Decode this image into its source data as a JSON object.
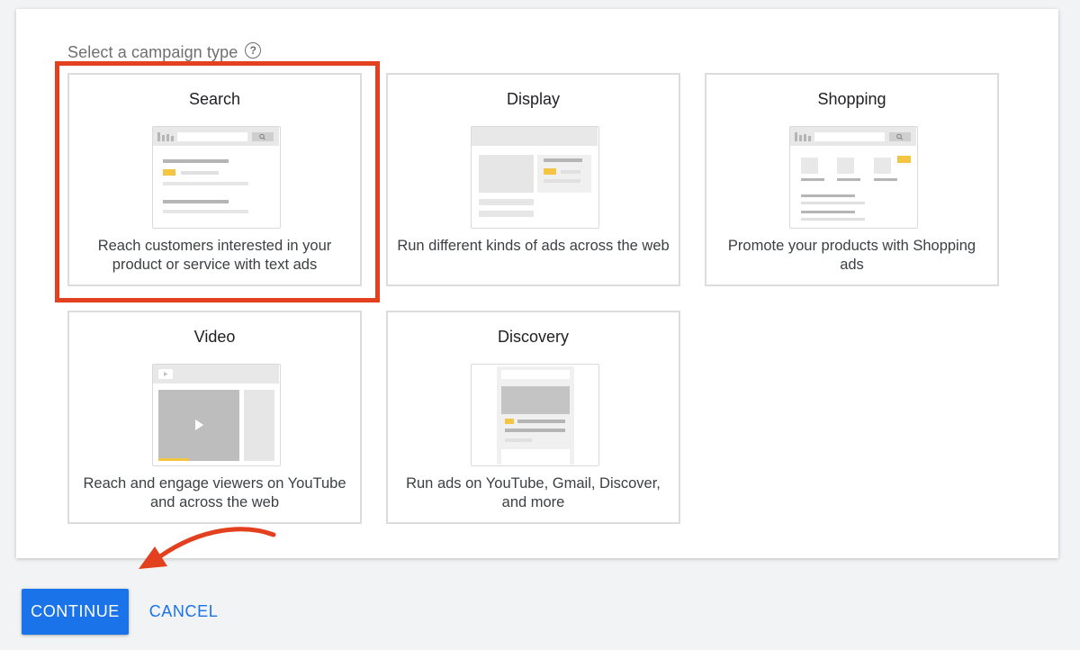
{
  "section": {
    "label": "Select a campaign type",
    "help_icon": "?"
  },
  "campaign_types": [
    {
      "title": "Search",
      "description": "Reach customers interested in your product or service with text ads",
      "selected": true
    },
    {
      "title": "Display",
      "description": "Run different kinds of ads across the web",
      "selected": false
    },
    {
      "title": "Shopping",
      "description": "Promote your products with Shopping ads",
      "selected": false
    },
    {
      "title": "Video",
      "description": "Reach and engage viewers on YouTube and across the web",
      "selected": false
    },
    {
      "title": "Discovery",
      "description": "Run ads on YouTube, Gmail, Discover, and more",
      "selected": false
    }
  ],
  "actions": {
    "continue_label": "CONTINUE",
    "cancel_label": "CANCEL"
  },
  "colors": {
    "accent": "#1a73e8",
    "highlight": "#e2401e",
    "thumb_yellow": "#f4c542"
  },
  "icons": {
    "help": "help-circle-icon",
    "annotation": "curved-arrow-icon"
  }
}
